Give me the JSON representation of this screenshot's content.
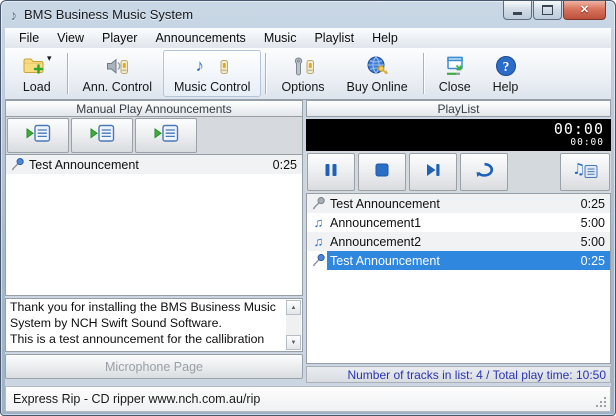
{
  "window": {
    "title": "BMS Business Music System",
    "app_icon": "music-note-icon",
    "controls": [
      "minimize",
      "maximize",
      "close"
    ]
  },
  "menu_bar": {
    "items": [
      "File",
      "View",
      "Player",
      "Announcements",
      "Music",
      "Playlist",
      "Help"
    ]
  },
  "toolbar": {
    "buttons": [
      {
        "label": "Load",
        "icon": "folder-add-icon",
        "group": 0,
        "has_dropdown": true,
        "active": false
      },
      {
        "label": "Ann. Control",
        "icon": "speaker-fader-icon",
        "group": 1,
        "has_dropdown": false,
        "active": false
      },
      {
        "label": "Music Control",
        "icon": "note-fader-icon",
        "group": 1,
        "has_dropdown": false,
        "active": true
      },
      {
        "label": "Options",
        "icon": "tools-fader-icon",
        "group": 2,
        "has_dropdown": false,
        "active": false
      },
      {
        "label": "Buy Online",
        "icon": "globe-key-icon",
        "group": 2,
        "has_dropdown": false,
        "active": false
      },
      {
        "label": "Close",
        "icon": "close-window-icon",
        "group": 3,
        "has_dropdown": false,
        "active": false
      },
      {
        "label": "Help",
        "icon": "help-icon",
        "group": 3,
        "has_dropdown": false,
        "active": false
      }
    ]
  },
  "left_panel": {
    "header": "Manual Play Announcements",
    "play_buttons": [
      {
        "icon": "play-list-icon"
      },
      {
        "icon": "play-list-icon"
      },
      {
        "icon": "play-list-icon"
      }
    ],
    "announcements": [
      {
        "icon": "microphone-blue-icon",
        "name": "Test Announcement",
        "duration": "0:25",
        "selected": false
      }
    ],
    "info_text": "Thank you for installing the BMS Business Music System by NCH Swift Sound Software.\nThis is a test announcement for the callibration",
    "microphone_page_label": "Microphone Page"
  },
  "playlist_panel": {
    "header": "PlayList",
    "lcd": {
      "elapsed": "00:00",
      "remaining": "00:00"
    },
    "transport": [
      {
        "name": "pause",
        "icon": "pause-icon"
      },
      {
        "name": "stop",
        "icon": "stop-icon"
      },
      {
        "name": "next",
        "icon": "next-icon"
      },
      {
        "name": "repeat",
        "icon": "repeat-icon"
      }
    ],
    "music_list_button": {
      "name": "music-list",
      "icon": "music-list-icon"
    },
    "tracks": [
      {
        "icon": "microphone-gray-icon",
        "name": "Test Announcement",
        "duration": "0:25",
        "selected": false
      },
      {
        "icon": "music-note-icon",
        "name": "Announcement1",
        "duration": "5:00",
        "selected": false
      },
      {
        "icon": "music-note-icon",
        "name": "Announcement2",
        "duration": "5:00",
        "selected": false
      },
      {
        "icon": "microphone-blue-icon",
        "name": "Test Announcement",
        "duration": "0:25",
        "selected": true
      }
    ],
    "summary": "Number of tracks in list: 4 / Total play time: 10:50"
  },
  "status_bar": {
    "text": "Express Rip - CD ripper www.nch.com.au/rip"
  },
  "colors": {
    "selection": "#2f87de",
    "accent_blue": "#1e62b8",
    "summary_text": "#2b35af",
    "lcd_bg": "#000000",
    "lcd_text": "#ffffff"
  }
}
